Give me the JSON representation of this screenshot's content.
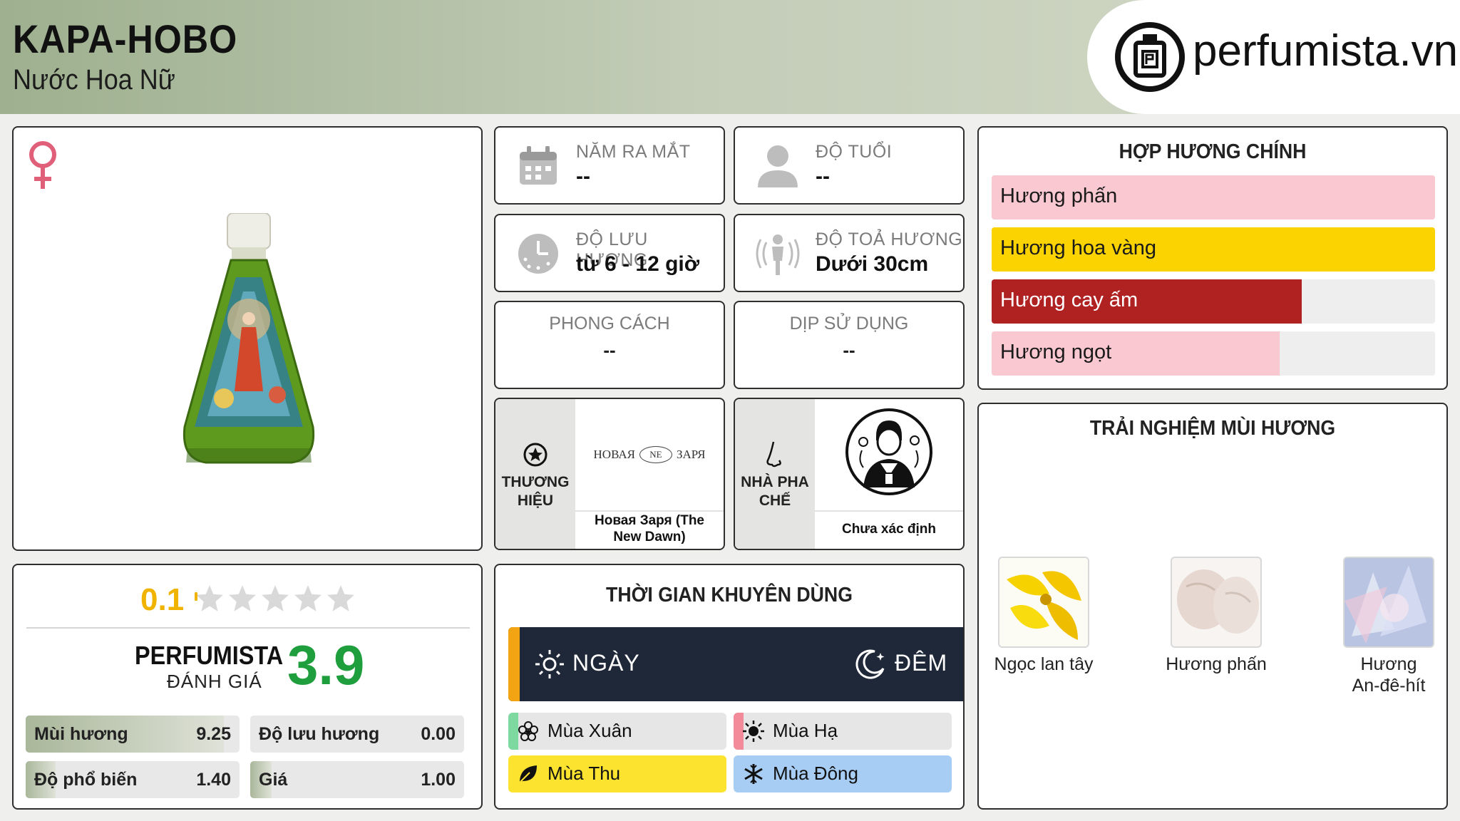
{
  "header": {
    "product_name": "KAPA-HOBO",
    "category": "Nước Hoa Nữ",
    "logo_text": "perfumista.vn",
    "logo_icon": "perfume-bottle-logo-icon"
  },
  "gender_icon": "female-icon",
  "info": {
    "release_year": {
      "label": "NĂM RA MẮT",
      "value": "--",
      "icon": "calendar-icon"
    },
    "age": {
      "label": "ĐỘ TUỔI",
      "value": "--",
      "icon": "user-icon"
    },
    "longevity": {
      "label": "ĐỘ LƯU HƯƠNG",
      "value": "từ 6 - 12 giờ",
      "icon": "clock-icon"
    },
    "sillage": {
      "label": "ĐỘ TOẢ HƯƠNG",
      "value": "Dưới 30cm",
      "icon": "sillage-person-icon"
    },
    "style": {
      "label": "PHONG CÁCH",
      "value": "--"
    },
    "occasion": {
      "label": "DỊP SỬ DỤNG",
      "value": "--"
    }
  },
  "brand": {
    "label_line1": "THƯƠNG",
    "label_line2": "HIỆU",
    "logo_left": "НОВАЯ",
    "logo_mid": "NE",
    "logo_right": "ЗАРЯ",
    "name": "Новая Заря (The New Dawn)",
    "icon": "star-badge-icon"
  },
  "perfumer": {
    "label_line1": "NHÀ PHA",
    "label_line2": "CHẾ",
    "name": "Chưa xác định",
    "icon": "nose-icon"
  },
  "main_accords": {
    "title": "HỢP HƯƠNG CHÍNH",
    "items": [
      {
        "label": "Hương phấn",
        "percent": 100,
        "color": "#f9c8d0"
      },
      {
        "label": "Hương hoa vàng",
        "percent": 100,
        "color": "#fad301"
      },
      {
        "label": "Hương cay ấm",
        "percent": 70,
        "color": "#b02222"
      },
      {
        "label": "Hương ngọt",
        "percent": 65,
        "color": "#f9c8d0"
      }
    ]
  },
  "rating": {
    "user_score": "0.1",
    "stars_total": 5,
    "stars_filled": 0.02,
    "perfumista_label": "PERFUMISTA",
    "perfumista_sub": "ĐÁNH GIÁ",
    "perfumista_score": "3.9",
    "scores": [
      {
        "label": "Mùi hương",
        "value": "9.25",
        "fraction": 0.925
      },
      {
        "label": "Độ lưu hương",
        "value": "0.00",
        "fraction": 0
      },
      {
        "label": "Độ phổ biến",
        "value": "1.40",
        "fraction": 0.14
      },
      {
        "label": "Giá",
        "value": "1.00",
        "fraction": 0.1
      }
    ]
  },
  "time_of_use": {
    "title": "THỜI GIAN KHUYÊN DÙNG",
    "day": "NGÀY",
    "night": "ĐÊM",
    "seasons": {
      "spring": {
        "label": "Mùa Xuân",
        "color": "#7ed9a0",
        "icon": "spring-flower-icon"
      },
      "summer": {
        "label": "Mùa Hạ",
        "color": "#f28a9a",
        "icon": "sun-icon"
      },
      "autumn": {
        "label": "Mùa Thu",
        "color": "#fbe330",
        "icon": "leaf-icon"
      },
      "winter": {
        "label": "Mùa Đông",
        "color": "#a8cdf5",
        "icon": "snowflake-icon"
      }
    }
  },
  "scent_experience": {
    "title": "TRẢI NGHIỆM MÙI HƯƠNG",
    "notes": [
      {
        "label": "Ngọc lan tây",
        "icon": "ylang-ylang-image"
      },
      {
        "label": "Hương phấn",
        "icon": "powder-image"
      },
      {
        "label": "Hương An-đê-hít",
        "icon": "aldehyde-image"
      }
    ]
  }
}
